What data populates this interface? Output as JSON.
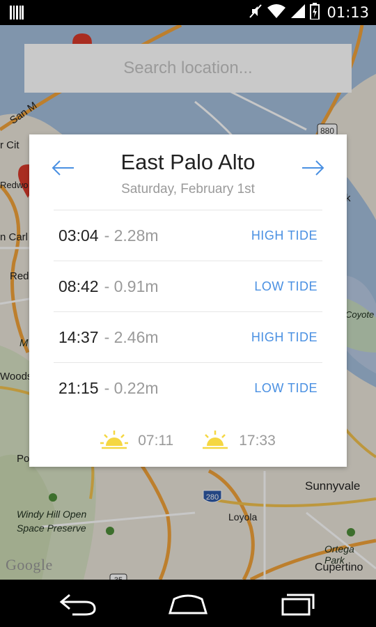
{
  "status": {
    "time": "01:13"
  },
  "search": {
    "placeholder": "Search location..."
  },
  "card": {
    "location": "East Palo Alto",
    "date": "Saturday, February 1st",
    "tides": [
      {
        "time": "03:04",
        "height": "- 2.28m",
        "type": "HIGH TIDE"
      },
      {
        "time": "08:42",
        "height": "- 0.91m",
        "type": "LOW TIDE"
      },
      {
        "time": "14:37",
        "height": "- 2.46m",
        "type": "HIGH TIDE"
      },
      {
        "time": "21:15",
        "height": "- 0.22m",
        "type": "LOW TIDE"
      }
    ],
    "sunrise": "07:11",
    "sunset": "17:33"
  },
  "map": {
    "labels": [
      "San M",
      "r Cit",
      "Redwo",
      "n Carl",
      "Red",
      "M",
      "Woods",
      "Po",
      "Windy Hill Open",
      "Space Preserve",
      "Loyola",
      "Sunnyvale",
      "Ortega Park",
      "Cupertino",
      "Coyote",
      "k"
    ],
    "highways": [
      "880",
      "280",
      "35"
    ],
    "logo": "Google"
  },
  "colors": {
    "accent": "#4a90e2",
    "sun": "#f5d742",
    "water": "#a5bfdd"
  }
}
